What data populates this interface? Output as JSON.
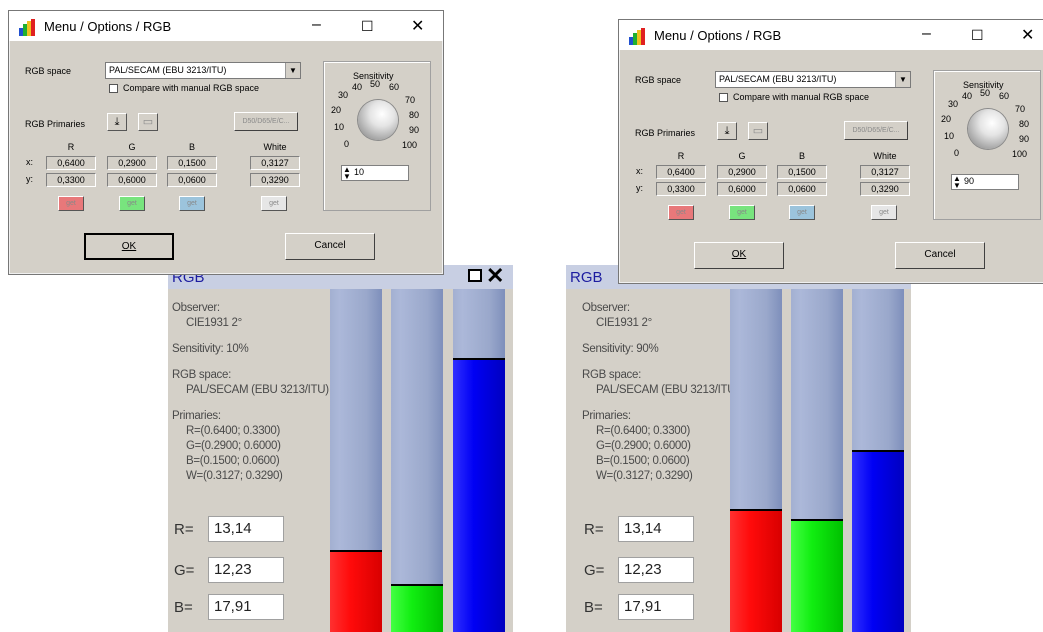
{
  "dialog": {
    "title": "Menu / Options / RGB",
    "rgb_space_label": "RGB space",
    "rgb_space_value": "PAL/SECAM (EBU 3213/ITU)",
    "compare_label": "Compare with manual RGB space",
    "primaries_label": "RGB Primaries",
    "illum_button": "D50/D65/E/C...",
    "columns": [
      "R",
      "G",
      "B",
      "White"
    ],
    "row_labels": [
      "x:",
      "y:"
    ],
    "x_values": [
      "0,6400",
      "0,2900",
      "0,1500",
      "0,3127"
    ],
    "y_values": [
      "0,3300",
      "0,6000",
      "0,0600",
      "0,3290"
    ],
    "get_label": "get",
    "sensitivity_label": "Sensitivity",
    "dial_ticks": [
      "0",
      "10",
      "20",
      "30",
      "40",
      "50",
      "60",
      "70",
      "80",
      "90",
      "100"
    ],
    "ok_label": "OK",
    "cancel_label": "Cancel",
    "min_icon": "minimize-icon",
    "max_icon": "maximize-icon",
    "close_icon": "close-icon"
  },
  "dialogs": [
    {
      "sensitivity_value": "10"
    },
    {
      "sensitivity_value": "90"
    }
  ],
  "rgb_window": {
    "title": "RGB",
    "observer_label": "Observer:",
    "observer_value": "CIE1931 2°",
    "rgb_space_label": "RGB space:",
    "rgb_space_value": "PAL/SECAM (EBU 3213/ITU)",
    "primaries_label": "Primaries:",
    "primaries": [
      "R=(0.6400; 0.3300)",
      "G=(0.2900; 0.6000)",
      "B=(0.1500; 0.0600)",
      "W=(0.3127; 0.3290)"
    ],
    "r_label": "R=",
    "g_label": "G=",
    "b_label": "B=",
    "r_value": "13,14",
    "g_value": "12,23",
    "b_value": "17,91"
  },
  "windows": [
    {
      "sensitivity_text": "Sensitivity: 10%",
      "bar_levels": {
        "r": 0.24,
        "g": 0.14,
        "b": 0.8
      }
    },
    {
      "sensitivity_text": "Sensitivity: 90%",
      "bar_levels": {
        "r": 0.36,
        "g": 0.33,
        "b": 0.53
      }
    }
  ],
  "colors": {
    "red": "#ff1a1a",
    "green": "#22ee22",
    "blue": "#0a0af0",
    "bar_background": "#a3b0d1"
  }
}
